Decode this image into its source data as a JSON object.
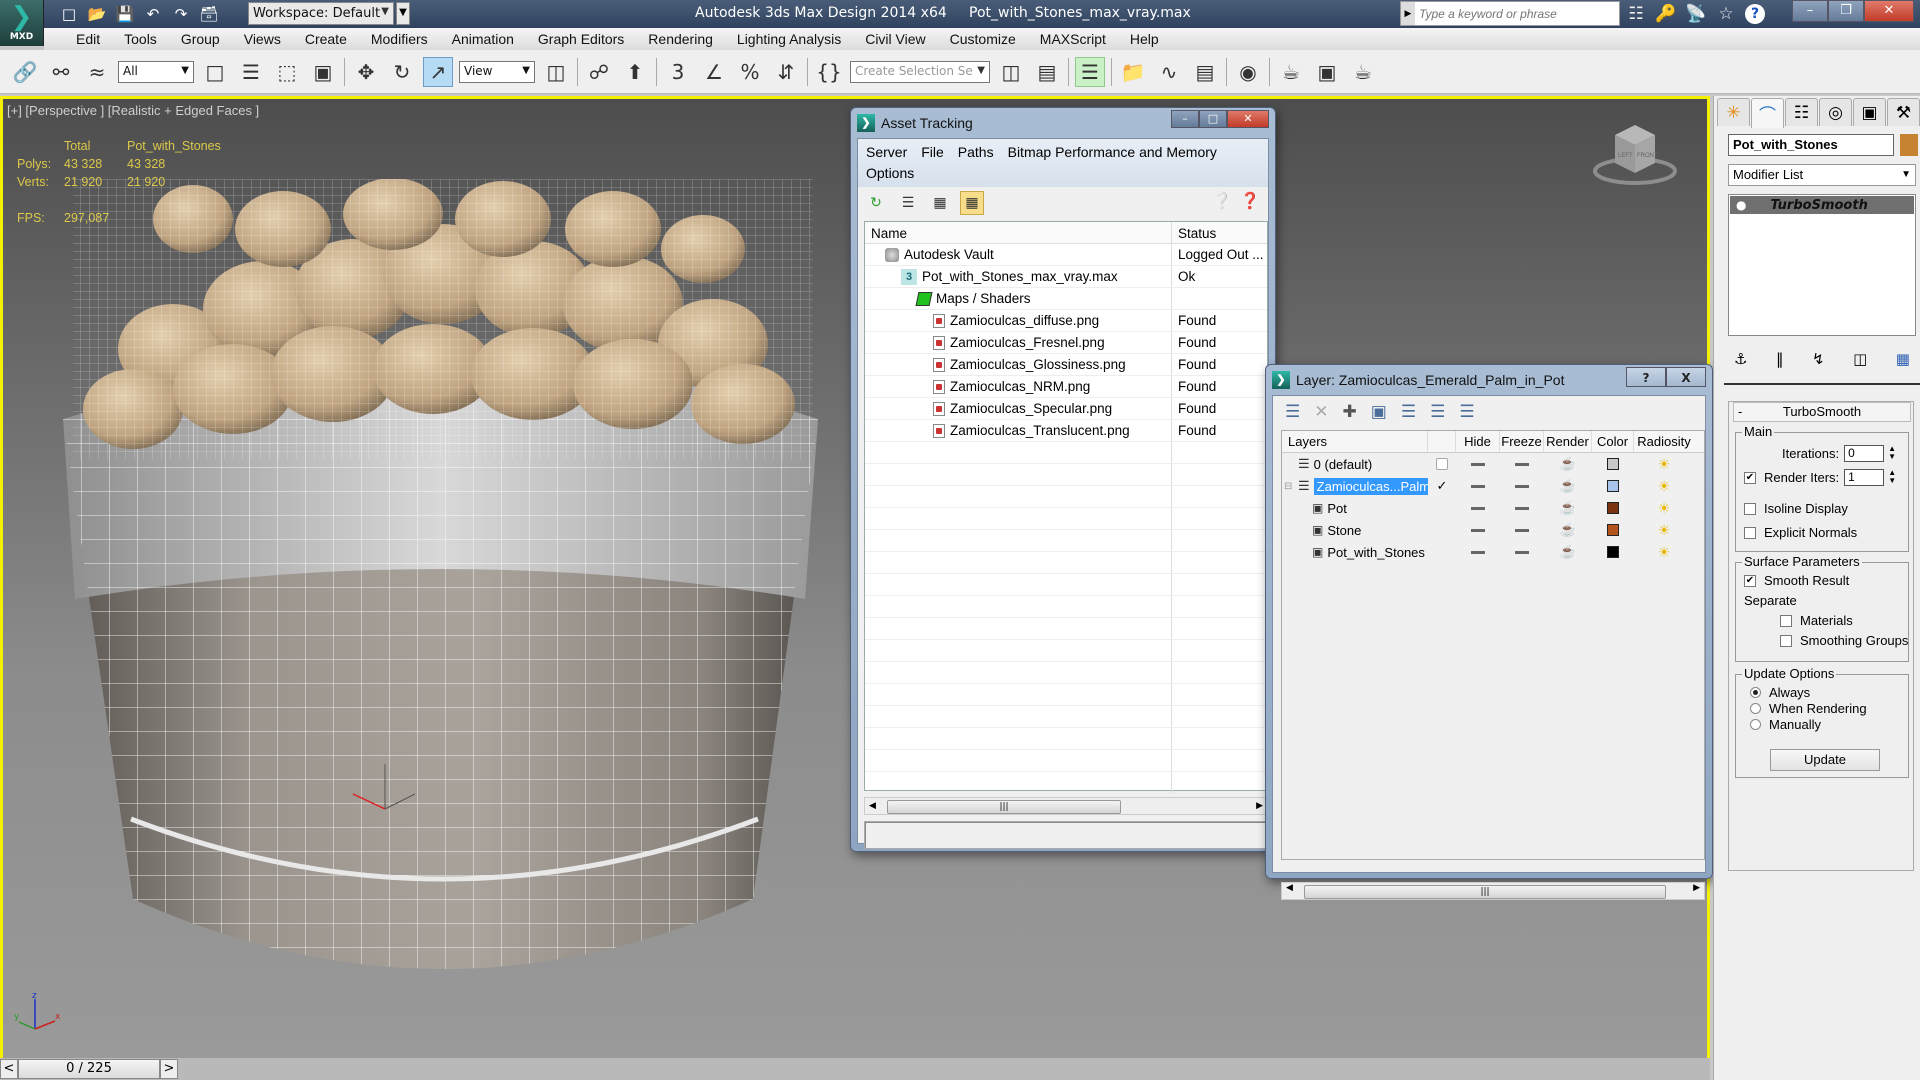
{
  "app": {
    "logo_label": "MXD",
    "workspace": "Workspace: Default",
    "title": "Autodesk 3ds Max Design 2014 x64     Pot_with_Stones_max_vray.max",
    "search_placeholder": "Type a keyword or phrase"
  },
  "menu": [
    "Edit",
    "Tools",
    "Group",
    "Views",
    "Create",
    "Modifiers",
    "Animation",
    "Graph Editors",
    "Rendering",
    "Lighting Analysis",
    "Civil View",
    "Customize",
    "MAXScript",
    "Help"
  ],
  "toolbar": {
    "selection_filter": "All",
    "reference_coord": "View",
    "snap_label": "3",
    "selection_set_placeholder": "Create Selection Se"
  },
  "viewport": {
    "label": "[+] [Perspective ] [Realistic + Edged Faces ]",
    "stats": {
      "header_total": "Total",
      "header_object": "Pot_with_Stones",
      "polys_label": "Polys:",
      "polys_total": "43 328",
      "polys_object": "43 328",
      "verts_label": "Verts:",
      "verts_total": "21 920",
      "verts_object": "21 920",
      "fps_label": "FPS:",
      "fps_value": "297,087"
    },
    "viewcube_left": "LEFT",
    "viewcube_front": "FRONT",
    "axis_x": "x",
    "axis_y": "y",
    "axis_z": "z"
  },
  "timeline": {
    "prev": "<",
    "frame": "0 / 225",
    "next": ">"
  },
  "asset_tracking": {
    "title": "Asset Tracking",
    "menu_row1": [
      "Server",
      "File",
      "Paths",
      "Bitmap Performance and Memory"
    ],
    "menu_row2": [
      "Options"
    ],
    "columns": {
      "name": "Name",
      "status": "Status"
    },
    "rows": [
      {
        "name": "Autodesk Vault",
        "status": "Logged Out ...",
        "icon": "vault-icon",
        "level": 1
      },
      {
        "name": "Pot_with_Stones_max_vray.max",
        "status": "Ok",
        "icon": "max-file-icon",
        "level": 2
      },
      {
        "name": "Maps / Shaders",
        "status": "",
        "icon": "maps-icon",
        "level": 3
      },
      {
        "name": "Zamioculcas_diffuse.png",
        "status": "Found",
        "icon": "image-file-icon",
        "level": 4
      },
      {
        "name": "Zamioculcas_Fresnel.png",
        "status": "Found",
        "icon": "image-file-icon",
        "level": 4
      },
      {
        "name": "Zamioculcas_Glossiness.png",
        "status": "Found",
        "icon": "image-file-icon",
        "level": 4
      },
      {
        "name": "Zamioculcas_NRM.png",
        "status": "Found",
        "icon": "image-file-icon",
        "level": 4
      },
      {
        "name": "Zamioculcas_Specular.png",
        "status": "Found",
        "icon": "image-file-icon",
        "level": 4
      },
      {
        "name": "Zamioculcas_Translucent.png",
        "status": "Found",
        "icon": "image-file-icon",
        "level": 4
      }
    ]
  },
  "layer_dialog": {
    "title": "Layer: Zamioculcas_Emerald_Palm_in_Pot",
    "help": "?",
    "close": "X",
    "columns": {
      "layers": "Layers",
      "hide": "Hide",
      "freeze": "Freeze",
      "render": "Render",
      "color": "Color",
      "radiosity": "Radiosity"
    },
    "rows": [
      {
        "name": "0 (default)",
        "type": "layer",
        "current": false,
        "selected": false,
        "color": "#c8c8c8"
      },
      {
        "name": "Zamioculcas...Palm_",
        "type": "layer",
        "current": true,
        "selected": true,
        "color": "#a8c4ea"
      },
      {
        "name": "Pot",
        "type": "object",
        "current": false,
        "selected": false,
        "color": "#7a3410"
      },
      {
        "name": "Stone",
        "type": "object",
        "current": false,
        "selected": false,
        "color": "#b3541c"
      },
      {
        "name": "Pot_with_Stones",
        "type": "object",
        "current": false,
        "selected": false,
        "color": "#000000"
      }
    ]
  },
  "command_panel": {
    "object_name": "Pot_with_Stones",
    "object_color": "#c68332",
    "modifier_list": "Modifier List",
    "stack": [
      "TurboSmooth"
    ],
    "rollout_title": "TurboSmooth",
    "main_group": "Main",
    "iterations_label": "Iterations:",
    "iterations_value": "0",
    "render_iters_label": "Render Iters:",
    "render_iters_value": "1",
    "render_iters_checked": true,
    "isoline_label": "Isoline Display",
    "isoline_checked": false,
    "explicit_normals_label": "Explicit Normals",
    "explicit_normals_checked": false,
    "surface_group": "Surface Parameters",
    "smooth_result_label": "Smooth Result",
    "smooth_result_checked": true,
    "separate_label": "Separate",
    "materials_label": "Materials",
    "materials_checked": false,
    "smoothing_groups_label": "Smoothing Groups",
    "smoothing_groups_checked": false,
    "update_group": "Update Options",
    "update_options": [
      "Always",
      "When Rendering",
      "Manually"
    ],
    "update_selected": "Always",
    "update_button": "Update"
  }
}
